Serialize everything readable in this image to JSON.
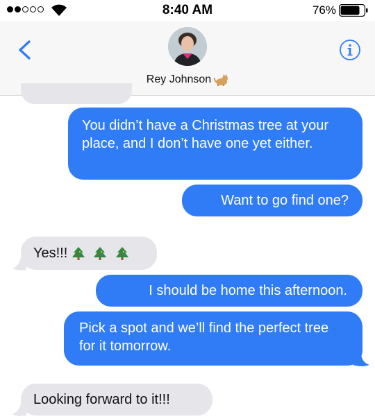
{
  "status_bar": {
    "time": "8:40 AM",
    "battery_percent": "76%",
    "signal_bars_filled": 2,
    "signal_bars_total": 5,
    "battery_level": 0.76
  },
  "header": {
    "contact_name": "Rey Johnson",
    "contact_emoji": "cat-icon"
  },
  "messages": [
    {
      "direction": "sent",
      "text": "You didn’t have a Christmas tree at your place, and I don’t have one yet either."
    },
    {
      "direction": "sent",
      "text": "Want to go find one?"
    },
    {
      "direction": "received",
      "text": "Yes!!!",
      "emoji": "christmas-tree-icon x3"
    },
    {
      "direction": "sent",
      "text": "I should be home this afternoon."
    },
    {
      "direction": "sent",
      "text": "Pick a spot and we’ll find the perfect tree for it tomorrow."
    },
    {
      "direction": "received",
      "text": "Looking forward to it!!!"
    }
  ],
  "colors": {
    "sent_bubble": "#2f7cf6",
    "received_bubble": "#e5e5ea",
    "accent": "#2f7cf6",
    "header_bg": "#f7f7f7"
  }
}
